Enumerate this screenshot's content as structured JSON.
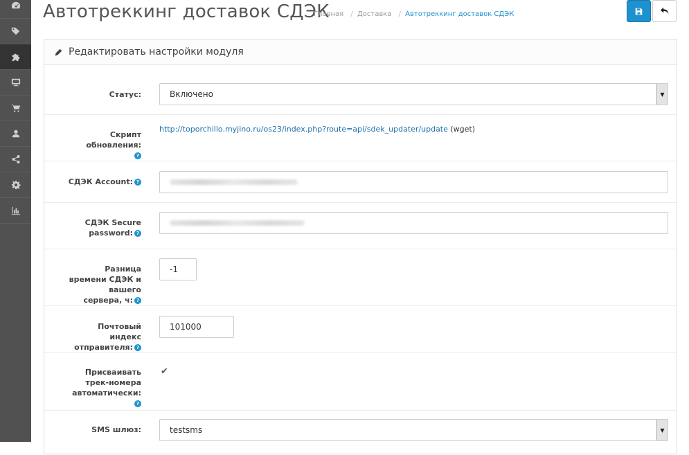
{
  "sidebar": {
    "items": [
      {
        "icon": "dashboard-icon",
        "active": false
      },
      {
        "icon": "tags-icon",
        "active": false
      },
      {
        "icon": "puzzle-icon",
        "active": true
      },
      {
        "icon": "desktop-icon",
        "active": false
      },
      {
        "icon": "shopping-cart-icon",
        "active": false
      },
      {
        "icon": "user-icon",
        "active": false
      },
      {
        "icon": "share-icon",
        "active": false
      },
      {
        "icon": "cog-icon",
        "active": false
      },
      {
        "icon": "bar-chart-icon",
        "active": false
      }
    ]
  },
  "header": {
    "title": "Автотреккинг доставок СДЭК",
    "breadcrumb": [
      "Главная",
      "Доставка",
      "Автотреккинг доставок СДЭК"
    ],
    "save_icon": "save-icon",
    "back_icon": "back-icon"
  },
  "panel": {
    "heading": "Редактировать настройки модуля",
    "heading_icon": "pencil-icon"
  },
  "form": {
    "status": {
      "label": "Статус:",
      "value": "Включено"
    },
    "script": {
      "label": "Скрипт обновления:",
      "url": "http://toporchillo.myjino.ru/os23/index.php?route=api/sdek_updater/update",
      "suffix": "(wget)"
    },
    "account": {
      "label": "СДЭК Account:"
    },
    "secure_password": {
      "label": "СДЭК Secure password:"
    },
    "time_diff": {
      "label": "Разница времени СДЭК и вашего сервера, ч:",
      "value": "-1"
    },
    "postcode": {
      "label": "Почтовый индекс отправителя:",
      "value": "101000"
    },
    "auto_track": {
      "label": "Присваивать трек-номера автоматически:",
      "checked": true,
      "check_glyph": "✔"
    },
    "sms_gateway": {
      "label": "SMS шлюз:",
      "value": "testsms"
    }
  },
  "help_glyph": "?",
  "select_arrow": "▼",
  "colors": {
    "accent": "#1e91cf",
    "sidebar": "#515151",
    "sidebar_active": "#333333"
  }
}
